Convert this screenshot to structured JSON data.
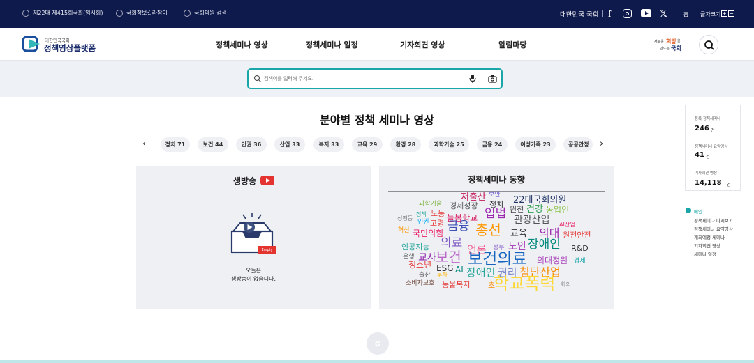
{
  "topbar": {
    "links": [
      "제22대 제415회국회(임시회)",
      "국회정보길라잡이",
      "국회의원 검색"
    ],
    "assembly": "대한민국 국회",
    "home": "홈",
    "font_size": "글자크기"
  },
  "header": {
    "logo_small": "대한민국국회",
    "logo_main": "정책영상플랫폼",
    "nav": [
      "정책세미나 영상",
      "정책세미나 일정",
      "기자회견 영상",
      "알림마당"
    ],
    "slogan_line1": "새로운",
    "slogan_hope": "희망",
    "slogan_line2": "을",
    "slogan_line3": "만드는",
    "slogan_line4": "국회"
  },
  "search": {
    "placeholder": "검색어를 입력해 주세요."
  },
  "section": {
    "title": "분야별 정책 세미나 영상"
  },
  "chips": [
    "정치 71",
    "보건 44",
    "인권 36",
    "산업 33",
    "복지 33",
    "교육 29",
    "환경 28",
    "과학기술 25",
    "금융 24",
    "여성가족 23",
    "공공안정"
  ],
  "live": {
    "title": "생방송",
    "empty_tag": "Empty",
    "message1": "오늘은",
    "message2": "생방송이 없습니다."
  },
  "trend": {
    "title": "정책세미나 동향"
  },
  "stats": [
    {
      "label": "등록 정책세미나",
      "value": "246",
      "unit": "건"
    },
    {
      "label": "정책세미나 요약영상",
      "value": "41",
      "unit": "건"
    },
    {
      "label": "기자회견 영상",
      "value": "14,118",
      "unit": "건"
    }
  ],
  "quick": {
    "head": "메인",
    "links": [
      "정책세미나 다시보기",
      "정책세미나 요약영상",
      "개최예정 세미나",
      "기자회견 영상",
      "세미나 일정"
    ]
  },
  "colors": {
    "navy": "#0e1a4c",
    "teal": "#1aa6a9",
    "live_red": "#e3342f"
  }
}
